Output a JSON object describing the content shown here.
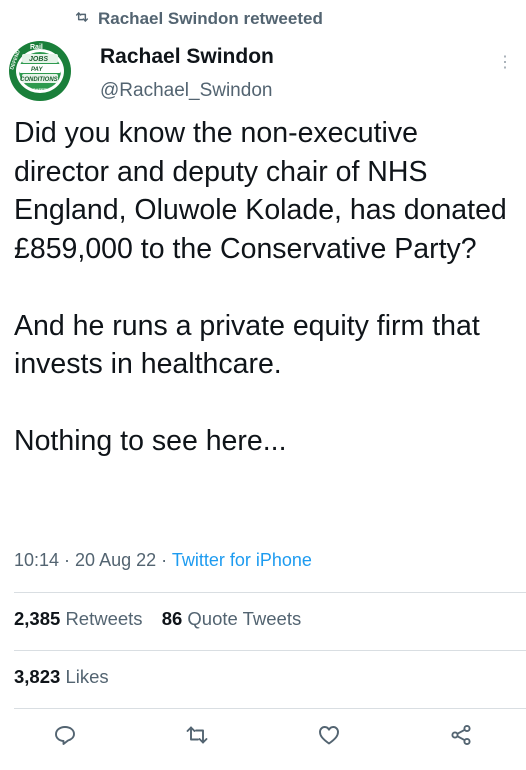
{
  "social_context": {
    "label": "Rachael Swindon retweeted"
  },
  "author": {
    "name": "Rachael Swindon",
    "handle": "@Rachael_Swindon",
    "avatar_badge_text": [
      "DEFEND",
      "Rail",
      "JOBS",
      "PAY",
      "CONDITIONS",
      "SAFETY"
    ]
  },
  "tweet": {
    "paragraph_1": "Did you know the non-executive director and deputy chair of NHS England, Oluwole Kolade, has donated £859,000 to the Conservative Party?",
    "paragraph_2": "And he runs a private equity firm that invests in healthcare.",
    "paragraph_3": "Nothing to see here..."
  },
  "meta": {
    "time": "10:14",
    "separator_1": " · ",
    "date": "20 Aug 22",
    "separator_2": " · ",
    "source": "Twitter for iPhone"
  },
  "stats": {
    "retweets_count": "2,385",
    "retweets_label": "Retweets",
    "quotes_count": "86",
    "quotes_label": "Quote Tweets",
    "likes_count": "3,823",
    "likes_label": "Likes"
  },
  "actions": [
    "reply-icon",
    "retweet-icon",
    "like-icon",
    "share-icon"
  ],
  "colors": {
    "link": "#1d9bf0",
    "secondary_text": "#536471",
    "primary_text": "#0f1419"
  }
}
